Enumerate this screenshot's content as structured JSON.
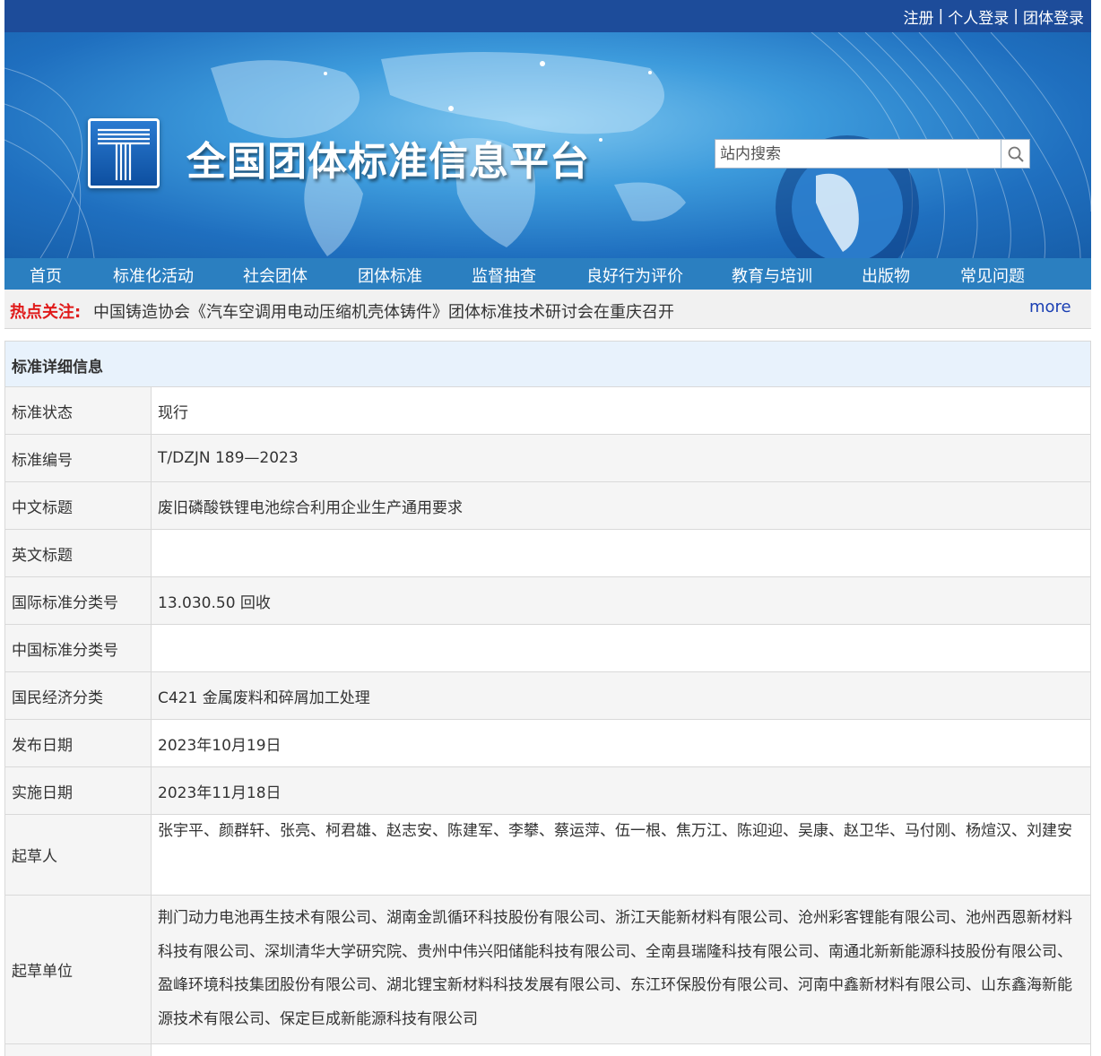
{
  "topbar": {
    "register": "注册",
    "personal_login": "个人登录",
    "group_login": "团体登录",
    "separator": "|"
  },
  "banner": {
    "site_title": "全国团体标准信息平台",
    "search_placeholder": "站内搜索"
  },
  "nav": {
    "items": [
      "首页",
      "标准化活动",
      "社会团体",
      "团体标准",
      "监督抽查",
      "良好行为评价",
      "教育与培训",
      "出版物",
      "常见问题"
    ]
  },
  "hot": {
    "label": "热点关注:",
    "news": "中国铸造协会《汽车空调用电动压缩机壳体铸件》团体标准技术研讨会在重庆召开",
    "more": "more"
  },
  "detail": {
    "heading": "标准详细信息",
    "rows": [
      {
        "key": "标准状态",
        "value": "现行"
      },
      {
        "key": "标准编号",
        "value": "T/DZJN 189—2023"
      },
      {
        "key": "中文标题",
        "value": "废旧磷酸铁锂电池综合利用企业生产通用要求"
      },
      {
        "key": "英文标题",
        "value": ""
      },
      {
        "key": "国际标准分类号",
        "value": "13.030.50 回收"
      },
      {
        "key": "中国标准分类号",
        "value": ""
      },
      {
        "key": "国民经济分类",
        "value": "C421 金属废料和碎屑加工处理"
      },
      {
        "key": "发布日期",
        "value": "2023年10月19日"
      },
      {
        "key": "实施日期",
        "value": "2023年11月18日"
      },
      {
        "key": "起草人",
        "value": "张宇平、颜群轩、张亮、柯君雄、赵志安、陈建军、李攀、蔡运萍、伍一根、焦万江、陈迎迎、吴康、赵卫华、马付刚、杨煊汉、刘建安"
      },
      {
        "key": "起草单位",
        "value": "荆门动力电池再生技术有限公司、湖南金凯循环科技股份有限公司、浙江天能新材料有限公司、沧州彩客锂能有限公司、池州西恩新材料科技有限公司、深圳清华大学研究院、贵州中伟兴阳储能科技有限公司、全南县瑞隆科技有限公司、南通北新新能源科技股份有限公司、盈峰环境科技集团股份有限公司、湖北锂宝新材料科技发展有限公司、东江环保股份有限公司、河南中鑫新材料有限公司、山东鑫海新能源技术有限公司、保定巨成新能源科技有限公司"
      }
    ]
  }
}
